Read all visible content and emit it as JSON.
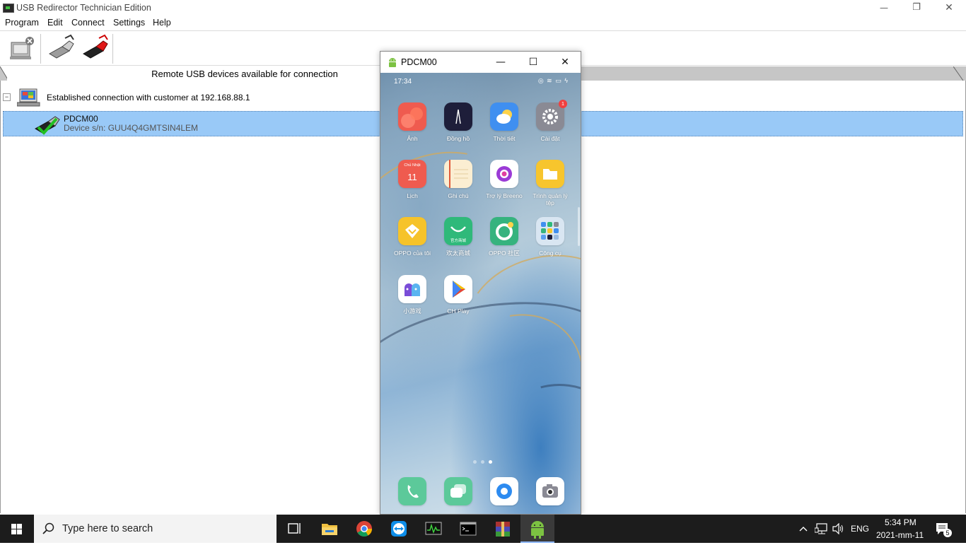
{
  "window": {
    "title": "USB Redirector Technician Edition",
    "minimize": "—",
    "restore": "❐",
    "close": "✕"
  },
  "menu": [
    "Program",
    "Edit",
    "Connect",
    "Settings",
    "Help"
  ],
  "panel": {
    "title": "Remote USB devices available for connection",
    "tree_toggle": "−",
    "connection_text": "Established connection with customer at 192.168.88.1",
    "device": {
      "name": "PDCM00",
      "serial": "Device s/n: GUU4Q4GMTSIN4LEM"
    }
  },
  "phone_window": {
    "title": "PDCM00",
    "minimize": "—",
    "maximize": "☐",
    "close": "✕",
    "status_time": "17:34",
    "status_icons": "◎ ≋ ▭ ϟ",
    "apps": [
      {
        "label": "Ảnh",
        "color": "#ef5b4f",
        "icon": "photos-icon"
      },
      {
        "label": "Đồng hồ",
        "color": "#1e1e3a",
        "icon": "clock-icon"
      },
      {
        "label": "Thời tiết",
        "color": "#3f8ff0",
        "icon": "weather-icon"
      },
      {
        "label": "Cài đặt",
        "color": "#8a8a94",
        "icon": "settings-icon",
        "badge": "1"
      },
      {
        "label": "Lịch",
        "color": "#ef5b4f",
        "icon": "calendar-icon",
        "tile_top": "Chủ Nhật",
        "tile_main": "11"
      },
      {
        "label": "Ghi chú",
        "color": "#fbeed2",
        "icon": "notes-icon"
      },
      {
        "label": "Trợ lý Breeno",
        "color": "#ffffff",
        "icon": "breeno-icon"
      },
      {
        "label": "Trình quản lý tệp",
        "color": "#f7c52d",
        "icon": "files-icon"
      },
      {
        "label": "OPPO của tôi",
        "color": "#f6c32a",
        "icon": "my-oppo-icon"
      },
      {
        "label": "欢太商城",
        "color": "#2fb97a",
        "icon": "store-icon",
        "tile_text": "官方商城"
      },
      {
        "label": "OPPO 社区",
        "color": "#36b37e",
        "icon": "community-icon"
      },
      {
        "label": "Công cụ",
        "color": "#d9e6f2",
        "icon": "tools-folder-icon"
      },
      {
        "label": "小游戏",
        "color": "#ffffff",
        "icon": "mini-games-icon"
      },
      {
        "label": "CH Play",
        "color": "#ffffff",
        "icon": "play-store-icon"
      }
    ],
    "dock": [
      {
        "color": "#5cc99a",
        "icon": "phone-icon"
      },
      {
        "color": "#5cc99a",
        "icon": "messages-icon"
      },
      {
        "color": "#ffffff",
        "icon": "browser-icon"
      },
      {
        "color": "#ffffff",
        "icon": "camera-icon"
      }
    ]
  },
  "taskbar": {
    "search_placeholder": "Type here to search",
    "lang": "ENG",
    "time": "5:34 PM",
    "date": "2021-mm-11",
    "notification_count": "5"
  }
}
